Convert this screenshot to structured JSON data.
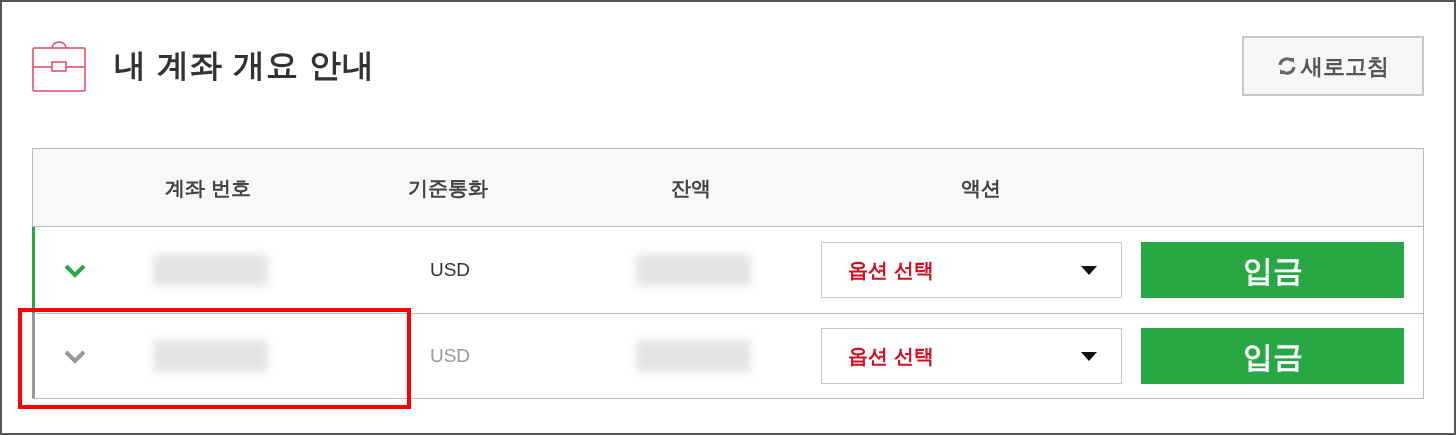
{
  "header": {
    "title": "내 계좌 개요 안내",
    "refresh_button": "새로고침"
  },
  "table": {
    "columns": [
      "계좌 번호",
      "기준통화",
      "잔액",
      "액션"
    ],
    "rows": [
      {
        "active": true,
        "account_redacted": true,
        "currency": "USD",
        "balance_redacted": true,
        "action_select": "옵션 선택",
        "deposit_button": "입금",
        "highlighted": false
      },
      {
        "active": false,
        "account_redacted": true,
        "currency": "USD",
        "balance_redacted": true,
        "action_select": "옵션 선택",
        "deposit_button": "입금",
        "highlighted": true
      }
    ]
  }
}
